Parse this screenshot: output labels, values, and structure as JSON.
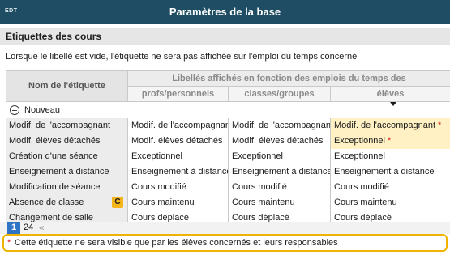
{
  "window": {
    "app_tag": "EDT",
    "title": "Paramètres de la base"
  },
  "section": {
    "title": "Etiquettes des cours",
    "description": "Lorsque le libellé est vide, l'étiquette ne sera pas affichée sur l'emploi du temps concerné"
  },
  "table": {
    "header_name": "Nom de l'étiquette",
    "header_group": "Libellés affichés en fonction des emplois du temps des",
    "columns": [
      "profs/personnels",
      "classes/groupes",
      "élèves"
    ],
    "new_label": "Nouveau",
    "star": "*",
    "rows": [
      {
        "name": "Modif. de l'accompagnant",
        "profs": "Modif. de l'accompagnant",
        "classes": "Modif. de l'accompagnant",
        "eleves": "Modif. de l'accompagnant"
      },
      {
        "name": "Modif. élèves détachés",
        "profs": "Modif. élèves détachés",
        "classes": "Modif. élèves détachés",
        "eleves": "Exceptionnel"
      },
      {
        "name": "Création d'une séance",
        "profs": "Exceptionnel",
        "classes": "Exceptionnel",
        "eleves": "Exceptionnel"
      },
      {
        "name": "Enseignement à distance",
        "profs": "Enseignement à distance",
        "classes": "Enseignement à distance",
        "eleves": "Enseignement à distance"
      },
      {
        "name": "Modification de séance",
        "profs": "Cours modifié",
        "classes": "Cours modifié",
        "eleves": "Cours modifié"
      },
      {
        "name": "Absence de classe",
        "badge": "C",
        "profs": "Cours maintenu",
        "classes": "Cours maintenu",
        "eleves": "Cours maintenu"
      },
      {
        "name": "Changement de salle",
        "profs": "Cours déplacé",
        "classes": "Cours déplacé",
        "eleves": "Cours déplacé"
      }
    ]
  },
  "pager": {
    "current": "1",
    "total": "24",
    "prev_glyph": "«"
  },
  "footnote": {
    "star": "*",
    "text": "Cette étiquette ne sera visible que par les élèves concernés et leurs responsables"
  },
  "colors": {
    "titlebar": "#1f4d63",
    "highlight_cell": "#fff1c4",
    "footnote_border": "#f0b400",
    "badge": "#f5b417",
    "pager_current": "#2f74c4"
  }
}
